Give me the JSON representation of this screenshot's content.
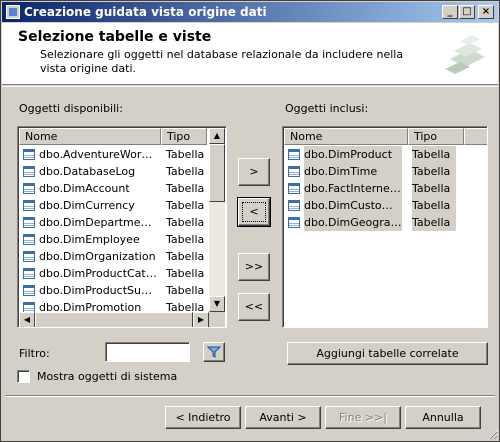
{
  "window": {
    "title": "Creazione guidata vista origine dati"
  },
  "header": {
    "title": "Selezione tabelle e viste",
    "description": "Selezionare gli oggetti nel database relazionale da includere nella vista origine dati."
  },
  "available": {
    "label": "Oggetti disponibili:",
    "col_name": "Nome",
    "col_type": "Tipo",
    "rows": [
      {
        "name": "dbo.AdventureWorks...",
        "type": "Tabella"
      },
      {
        "name": "dbo.DatabaseLog",
        "type": "Tabella"
      },
      {
        "name": "dbo.DimAccount",
        "type": "Tabella"
      },
      {
        "name": "dbo.DimCurrency",
        "type": "Tabella"
      },
      {
        "name": "dbo.DimDepartmentGr...",
        "type": "Tabella"
      },
      {
        "name": "dbo.DimEmployee",
        "type": "Tabella"
      },
      {
        "name": "dbo.DimOrganization",
        "type": "Tabella"
      },
      {
        "name": "dbo.DimProductCateg...",
        "type": "Tabella"
      },
      {
        "name": "dbo.DimProductSubca...",
        "type": "Tabella"
      },
      {
        "name": "dbo.DimPromotion",
        "type": "Tabella"
      }
    ]
  },
  "included": {
    "label": "Oggetti inclusi:",
    "col_name": "Nome",
    "col_type": "Tipo",
    "rows": [
      {
        "name": "dbo.DimProduct",
        "type": "Tabella"
      },
      {
        "name": "dbo.DimTime",
        "type": "Tabella"
      },
      {
        "name": "dbo.FactInternet...",
        "type": "Tabella"
      },
      {
        "name": "dbo.DimCustomer",
        "type": "Tabella"
      },
      {
        "name": "dbo.DimGeography",
        "type": "Tabella"
      }
    ]
  },
  "transfer": {
    "add": ">",
    "remove": "<",
    "add_all": ">>",
    "remove_all": "<<"
  },
  "filter": {
    "label": "Filtro:",
    "value": "",
    "icon": "filter-icon"
  },
  "related_button": "Aggiungi tabelle correlate",
  "show_system": {
    "label": "Mostra oggetti di sistema",
    "checked": false
  },
  "nav": {
    "back": "< Indietro",
    "next": "Avanti >",
    "finish": "Fine >>|",
    "cancel": "Annulla"
  }
}
